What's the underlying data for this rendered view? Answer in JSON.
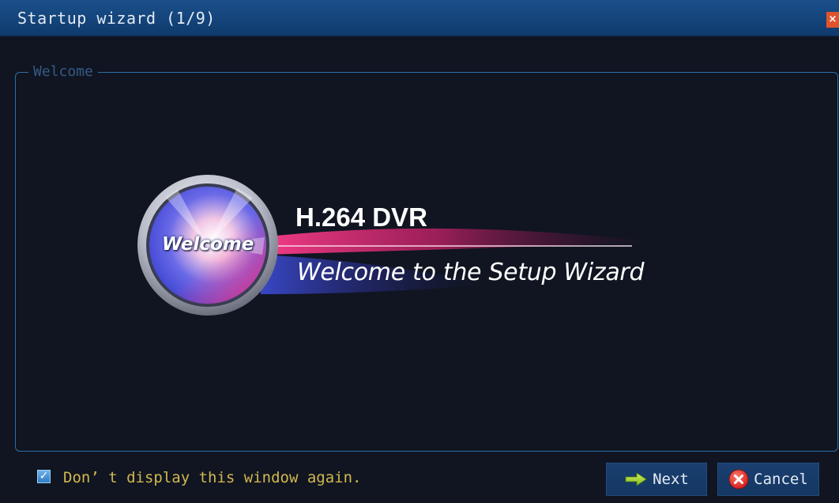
{
  "window": {
    "title": "Startup wizard (1/9)",
    "close_symbol": "×"
  },
  "group": {
    "legend": "Welcome"
  },
  "hero": {
    "badge_text": "Welcome",
    "product_title": "H.264 DVR",
    "subtitle": "Welcome to the Setup Wizard"
  },
  "footer": {
    "checkbox_checked": true,
    "checkbox_label": "Don’ t display this window again.",
    "next_label": "Next",
    "next_icon": "arrow-right-icon",
    "cancel_label": "Cancel",
    "cancel_icon": "close-circle-icon"
  },
  "colors": {
    "titlebar": "#134379",
    "background": "#101521",
    "border": "#2b6fa9",
    "label_yellow": "#d2b84e",
    "accent_pink": "#e0347a",
    "close_red": "#e0542c"
  }
}
